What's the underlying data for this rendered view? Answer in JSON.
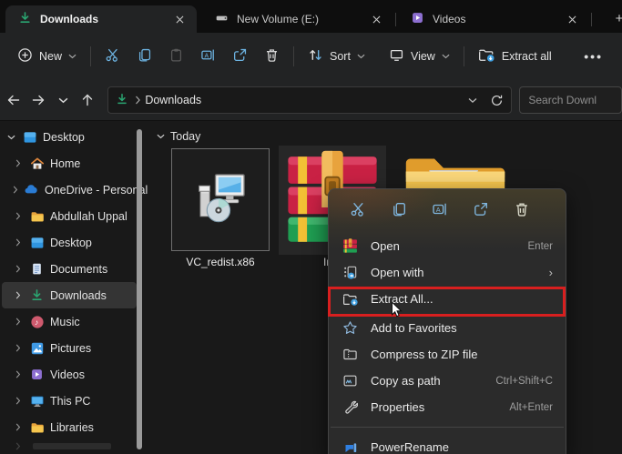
{
  "tabs_bar": {
    "tabs": [
      {
        "label": "Downloads",
        "icon": "download-icon",
        "active": true
      },
      {
        "label": "New Volume (E:)",
        "icon": "drive-icon",
        "active": false
      },
      {
        "label": "Videos",
        "icon": "video-icon",
        "active": false
      }
    ],
    "new_tab_label": "+"
  },
  "toolbar": {
    "new_label": "New",
    "sort_label": "Sort",
    "view_label": "View",
    "extract_all_label": "Extract all",
    "more_label": "•••",
    "icons": [
      "plus-icon",
      "cut-icon",
      "copy-icon",
      "paste-icon",
      "rename-icon",
      "share-icon",
      "delete-icon",
      "sort-icon",
      "view-icon",
      "extract-all-icon",
      "ellipsis-icon"
    ]
  },
  "address_bar": {
    "path_icon": "download-icon",
    "path": "Downloads",
    "search_placeholder": "Search Downl"
  },
  "sidebar": {
    "items": [
      {
        "label": "Desktop",
        "icon": "desktop-icon",
        "expanded": true,
        "level": 0
      },
      {
        "label": "Home",
        "icon": "home-icon",
        "level": 1
      },
      {
        "label": "OneDrive - Personal",
        "icon": "onedrive-icon",
        "level": 1
      },
      {
        "label": "Abdullah Uppal",
        "icon": "folder-icon",
        "level": 1
      },
      {
        "label": "Desktop",
        "icon": "desktop-icon",
        "level": 1
      },
      {
        "label": "Documents",
        "icon": "document-icon",
        "level": 1
      },
      {
        "label": "Downloads",
        "icon": "download-icon",
        "level": 1,
        "selected": true
      },
      {
        "label": "Music",
        "icon": "music-icon",
        "level": 1
      },
      {
        "label": "Pictures",
        "icon": "pictures-icon",
        "level": 1
      },
      {
        "label": "Videos",
        "icon": "video-icon",
        "level": 1
      },
      {
        "label": "This PC",
        "icon": "pc-icon",
        "level": 1
      },
      {
        "label": "Libraries",
        "icon": "folder-icon",
        "level": 1
      }
    ]
  },
  "content": {
    "group_header": "Today",
    "files": [
      {
        "label": "VC_redist.x86",
        "icon": "installer-icon",
        "selected": true
      },
      {
        "label": "Inte",
        "icon": "winrar-icon"
      },
      {
        "label": "",
        "icon": "folder-icon"
      }
    ]
  },
  "context_menu": {
    "quick_actions": [
      "cut-icon",
      "copy-icon",
      "rename-icon",
      "share-icon",
      "delete-icon"
    ],
    "items": [
      {
        "label": "Open",
        "shortcut": "Enter",
        "icon": "winrar-icon"
      },
      {
        "label": "Open with",
        "submenu": "›",
        "icon": "open-with-icon"
      },
      {
        "label": "Extract All...",
        "icon": "extract-icon",
        "annotated": true
      },
      {
        "label": "Add to Favorites",
        "icon": "star-icon"
      },
      {
        "label": "Compress to ZIP file",
        "icon": "zip-icon"
      },
      {
        "label": "Copy as path",
        "shortcut": "Ctrl+Shift+C",
        "icon": "copy-path-icon"
      },
      {
        "label": "Properties",
        "shortcut": "Alt+Enter",
        "icon": "properties-icon"
      },
      {
        "label": "PowerRename",
        "icon": "powerrename-icon"
      }
    ]
  },
  "colors": {
    "accent_blue": "#6cb2e0",
    "download_green": "#2aa571",
    "annotation_red": "#d81f1f",
    "folder_yellow": "#f6c64e",
    "toolbar_bg": "#222324",
    "body_bg": "#191919",
    "menu_bg": "#2b2b2b"
  }
}
